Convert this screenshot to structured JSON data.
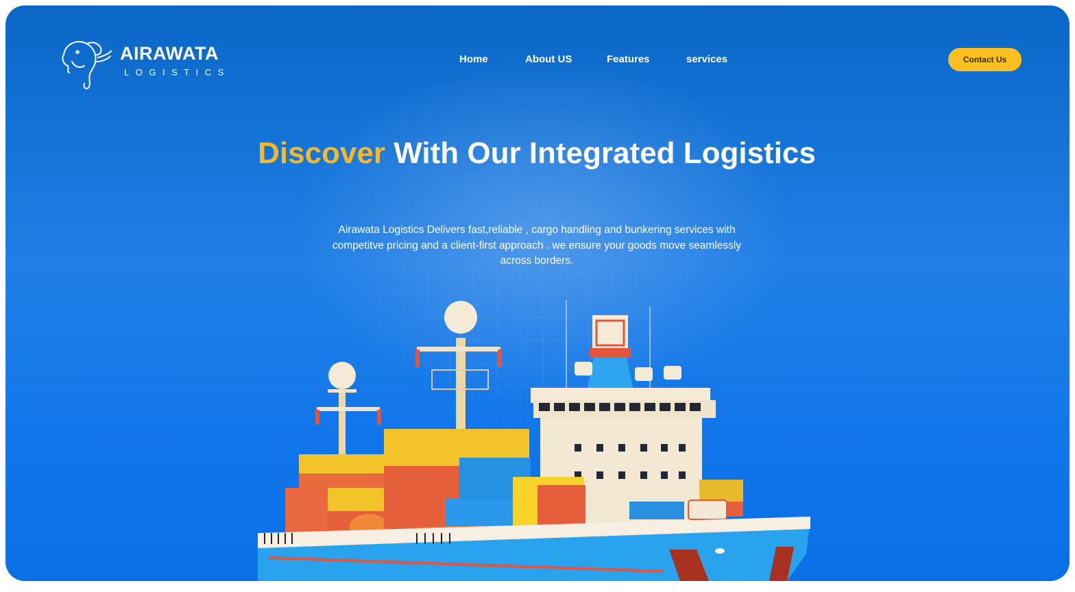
{
  "brand": {
    "name": "AIRAWATA",
    "tagline": "LOGISTICS"
  },
  "nav": {
    "items": [
      {
        "label": "Home"
      },
      {
        "label": "About US"
      },
      {
        "label": "Features"
      },
      {
        "label": "services"
      }
    ],
    "contact_label": "Contact Us"
  },
  "hero": {
    "title_accent": "Discover",
    "title_rest": "With Our Integrated Logistics",
    "description": "Airawata Logistics Delivers fast,reliable , cargo handling and bunkering services with competitve pricing and a client-first approach . we ensure your goods move seamlessly across borders."
  },
  "colors": {
    "background": "#1176ea",
    "accent": "#f7b92a",
    "button": "#fbbf1f"
  },
  "icons": {
    "logo": "elephant-icon",
    "hero_image": "container-ship-illustration"
  }
}
